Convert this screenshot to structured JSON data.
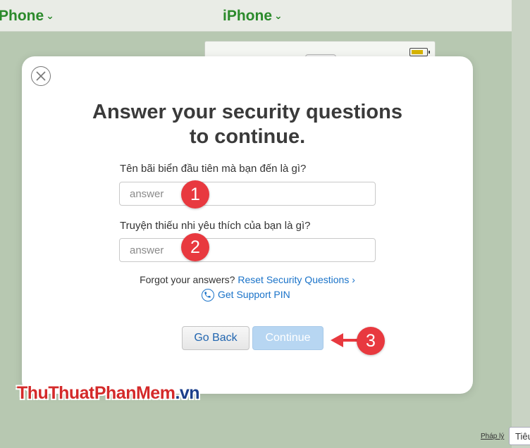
{
  "background": {
    "brand_left": "Phone",
    "brand_center": "iPhone",
    "footer_link": "Pháp lý",
    "footer_button": "Tiêu"
  },
  "modal": {
    "title_line1": "Answer your security questions",
    "title_line2": "to continue.",
    "question1": "Tên bãi biển đầu tiên mà bạn đến là gì?",
    "question2": "Truyện thiếu nhi yêu thích của bạn là gì?",
    "answer1_placeholder": "answer",
    "answer2_placeholder": "answer",
    "forgot_text": "Forgot your answers?",
    "reset_link": "Reset Security Questions",
    "support_link": "Get Support PIN",
    "go_back_label": "Go Back",
    "continue_label": "Continue"
  },
  "annotations": {
    "badge1": "1",
    "badge2": "2",
    "badge3": "3"
  },
  "watermark": {
    "part1": "ThuThuat",
    "part2": "PhanMem",
    "part3": ".vn"
  },
  "colors": {
    "accent": "#1a73c9",
    "badge": "#e8393f",
    "brand_green": "#2b8a2b"
  },
  "icons": {
    "close": "close-circle-icon",
    "phone": "phone-icon",
    "battery": "battery-icon",
    "chevron": "chevron-down-icon",
    "arrow": "arrow-left-icon"
  }
}
